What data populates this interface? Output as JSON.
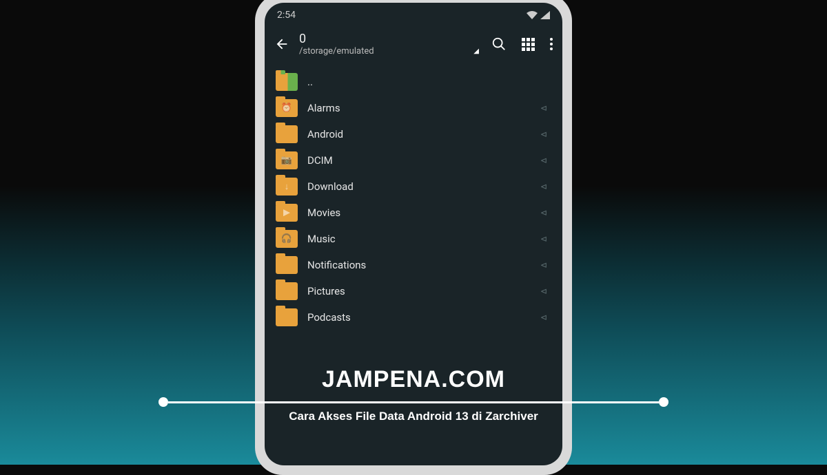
{
  "status_bar": {
    "time": "2:54"
  },
  "header": {
    "title": "0",
    "path": "/storage/emulated"
  },
  "files": [
    {
      "name": "..",
      "icon": "mixed",
      "glyph": "",
      "chevron": false
    },
    {
      "name": "Alarms",
      "icon": "orange",
      "glyph": "⏰",
      "chevron": true
    },
    {
      "name": "Android",
      "icon": "orange",
      "glyph": "",
      "chevron": true
    },
    {
      "name": "DCIM",
      "icon": "orange",
      "glyph": "📷",
      "chevron": true
    },
    {
      "name": "Download",
      "icon": "orange",
      "glyph": "↓",
      "chevron": true
    },
    {
      "name": "Movies",
      "icon": "orange",
      "glyph": "▶",
      "chevron": true
    },
    {
      "name": "Music",
      "icon": "orange",
      "glyph": "🎧",
      "chevron": true
    },
    {
      "name": "Notifications",
      "icon": "orange",
      "glyph": "",
      "chevron": true
    },
    {
      "name": "Pictures",
      "icon": "orange",
      "glyph": "",
      "chevron": true
    },
    {
      "name": "Podcasts",
      "icon": "orange",
      "glyph": "",
      "chevron": true
    }
  ],
  "watermark": {
    "title": "JAMPENA.COM",
    "subtitle": "Cara Akses File Data Android 13 di Zarchiver"
  }
}
